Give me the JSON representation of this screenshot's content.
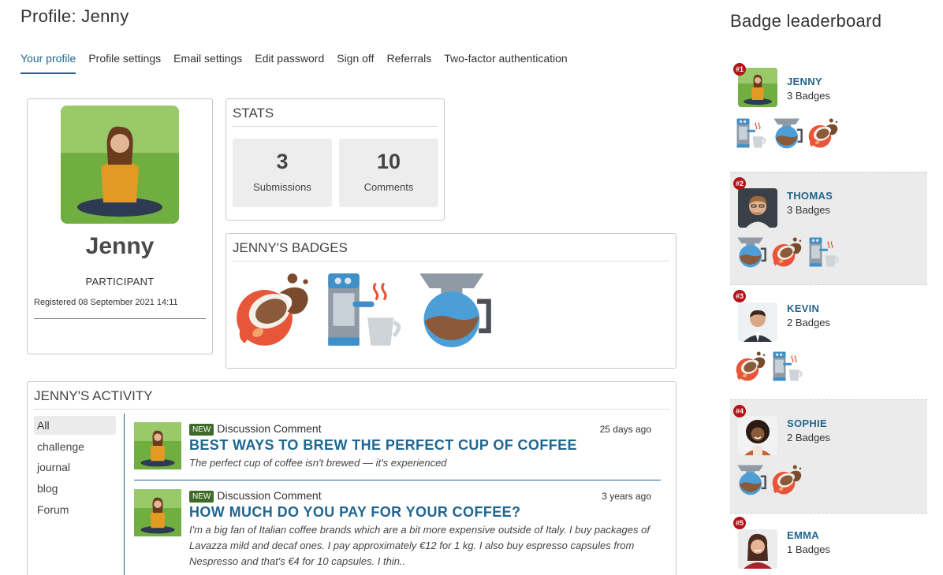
{
  "page_title": "Profile: Jenny",
  "tabs": [
    {
      "label": "Your profile",
      "active": true
    },
    {
      "label": "Profile settings"
    },
    {
      "label": "Email settings"
    },
    {
      "label": "Edit password"
    },
    {
      "label": "Sign off"
    },
    {
      "label": "Referrals"
    },
    {
      "label": "Two-factor authentication"
    }
  ],
  "profile": {
    "name": "Jenny",
    "role": "PARTICIPANT",
    "registered": "Registered 08 September 2021 14:11"
  },
  "stats": {
    "title": "STATS",
    "items": [
      {
        "value": "3",
        "label": "Submissions"
      },
      {
        "value": "10",
        "label": "Comments"
      }
    ]
  },
  "badges": {
    "title": "JENNY'S BADGES",
    "items": [
      "spilled-coffee-cup-badge",
      "espresso-machine-badge",
      "coffee-pot-badge"
    ]
  },
  "activity": {
    "title": "JENNY'S ACTIVITY",
    "filters": [
      "All",
      "challenge",
      "journal",
      "blog",
      "Forum"
    ],
    "items": [
      {
        "new_label": "NEW",
        "type": "Discussion Comment",
        "time": "25 days ago",
        "title": "BEST WAYS TO BREW THE PERFECT CUP OF COFFEE",
        "text": "The perfect cup of coffee isn't brewed — it's experienced"
      },
      {
        "new_label": "NEW",
        "type": "Discussion Comment",
        "time": "3 years ago",
        "title": "HOW MUCH DO YOU PAY FOR YOUR COFFEE?",
        "text": "I'm a big fan of Italian coffee brands which are a bit more expensive outside of Italy. I buy packages of Lavazza mild and decaf ones. I pay approximately €12 for 1 kg. I also buy espresso capsules from Nespresso and that's €4 for 10 capsules. I thin.."
      }
    ]
  },
  "leaderboard": {
    "title": "Badge leaderboard",
    "entries": [
      {
        "rank": "#1",
        "name": "JENNY",
        "count": "3 Badges"
      },
      {
        "rank": "#2",
        "name": "THOMAS",
        "count": "3 Badges"
      },
      {
        "rank": "#3",
        "name": "KEVIN",
        "count": "2 Badges"
      },
      {
        "rank": "#4",
        "name": "SOPHIE",
        "count": "2 Badges"
      },
      {
        "rank": "#5",
        "name": "EMMA",
        "count": "1 Badges"
      }
    ]
  },
  "colors": {
    "accent": "#1f6690",
    "new_badge": "#3e6b2a",
    "rank_badge": "#b31217"
  }
}
